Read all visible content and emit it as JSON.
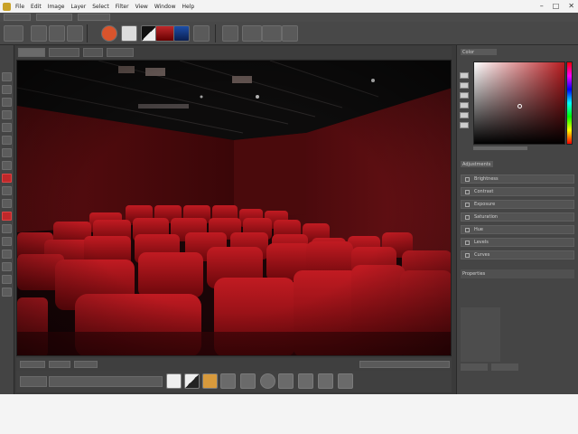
{
  "titlebar": {
    "menu": [
      "File",
      "Edit",
      "Image",
      "Layer",
      "Select",
      "Filter",
      "View",
      "Window",
      "Help"
    ],
    "controls": [
      "–",
      "□",
      "✕"
    ]
  },
  "right_panel": {
    "color_label": "Color",
    "adjust_label": "Adjustments",
    "rows": [
      "Brightness",
      "Contrast",
      "Exposure",
      "Saturation",
      "Hue",
      "Levels",
      "Curves"
    ],
    "properties_label": "Properties"
  },
  "colors": {
    "accent": "#c0282a",
    "seat_red": "#a5141b"
  }
}
